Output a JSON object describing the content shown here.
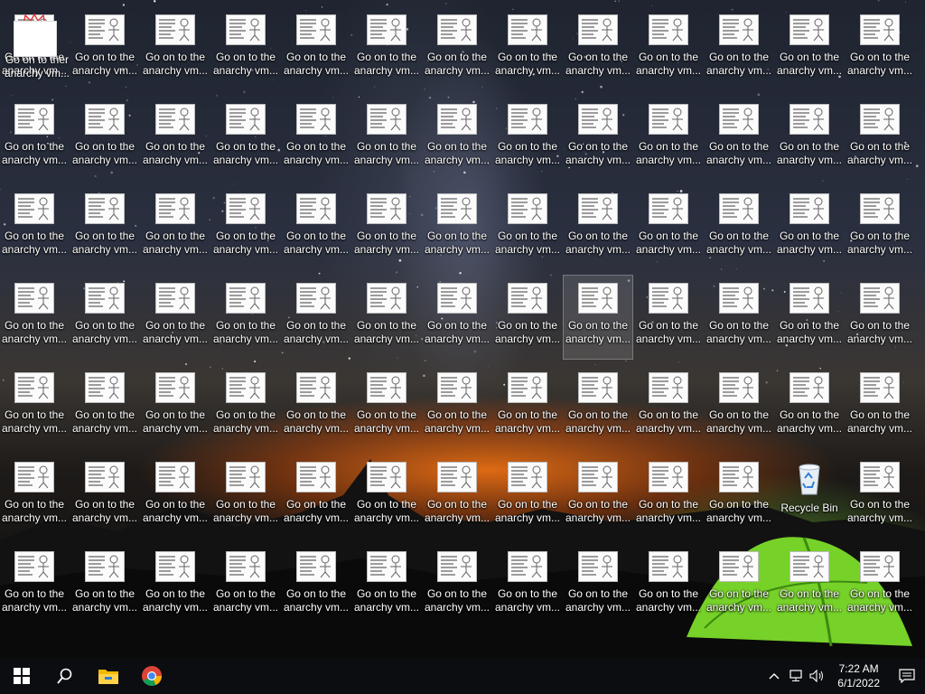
{
  "desktop": {
    "file_label_line1": "Go on to the",
    "file_label_line2": "anarchy vm...",
    "recycle_bin_label": "Recycle Bin",
    "overlay_label_line1": "Go on to ther",
    "overlay_label_line2": "anarchy vm..."
  },
  "taskbar": {
    "start_icon": "windows-logo-icon",
    "search_icon": "search-icon",
    "apps": [
      "file-explorer-icon",
      "chrome-icon"
    ]
  },
  "tray": {
    "time": "7:22 AM",
    "date": "6/1/2022"
  }
}
